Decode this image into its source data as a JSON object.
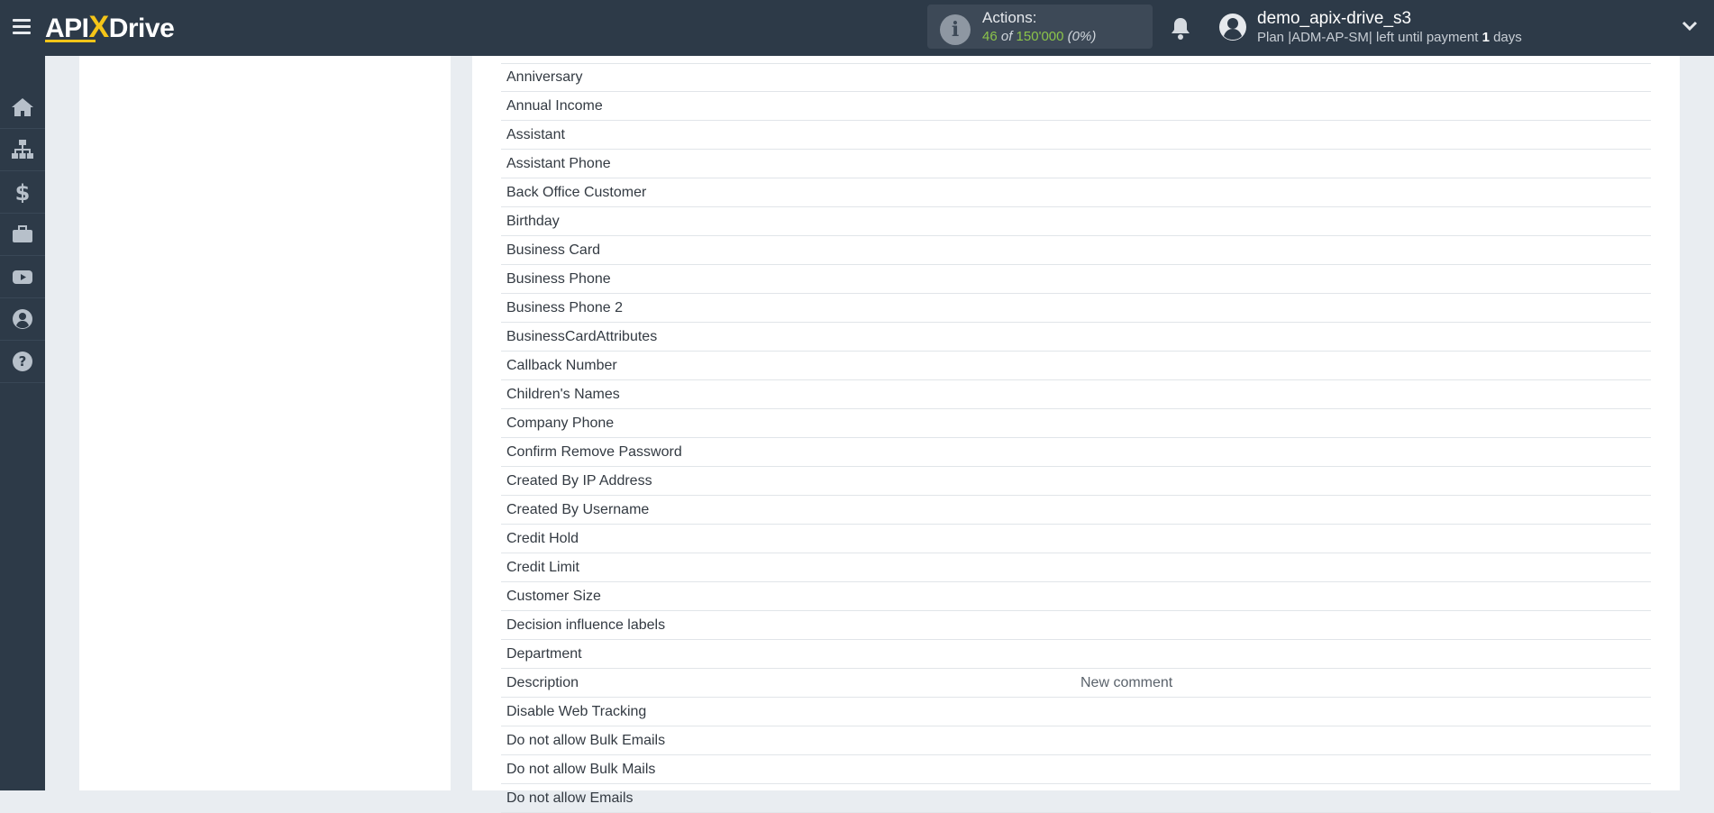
{
  "header": {
    "logo": {
      "api": "API",
      "x": "X",
      "drive": "Drive"
    },
    "actions": {
      "label": "Actions:",
      "used": "46",
      "of": "of",
      "total": "150'000",
      "percent": "(0%)"
    },
    "user": {
      "name": "demo_apix-drive_s3",
      "plan_prefix": "Plan |ADM-AP-SM| left until payment",
      "days_count": "1",
      "days_suffix": "days"
    }
  },
  "sidebar": {
    "items": [
      {
        "icon": "home-icon"
      },
      {
        "icon": "sitemap-icon"
      },
      {
        "icon": "dollar-icon"
      },
      {
        "icon": "briefcase-icon"
      },
      {
        "icon": "youtube-icon"
      },
      {
        "icon": "user-circle-icon"
      },
      {
        "icon": "question-circle-icon"
      }
    ]
  },
  "fields": [
    {
      "name": "Anniversary",
      "value": ""
    },
    {
      "name": "Annual Income",
      "value": ""
    },
    {
      "name": "Assistant",
      "value": ""
    },
    {
      "name": "Assistant Phone",
      "value": ""
    },
    {
      "name": "Back Office Customer",
      "value": ""
    },
    {
      "name": "Birthday",
      "value": ""
    },
    {
      "name": "Business Card",
      "value": ""
    },
    {
      "name": "Business Phone",
      "value": ""
    },
    {
      "name": "Business Phone 2",
      "value": ""
    },
    {
      "name": "BusinessCardAttributes",
      "value": ""
    },
    {
      "name": "Callback Number",
      "value": ""
    },
    {
      "name": "Children's Names",
      "value": ""
    },
    {
      "name": "Company Phone",
      "value": ""
    },
    {
      "name": "Confirm Remove Password",
      "value": ""
    },
    {
      "name": "Created By IP Address",
      "value": ""
    },
    {
      "name": "Created By Username",
      "value": ""
    },
    {
      "name": "Credit Hold",
      "value": ""
    },
    {
      "name": "Credit Limit",
      "value": ""
    },
    {
      "name": "Customer Size",
      "value": ""
    },
    {
      "name": "Decision influence labels",
      "value": ""
    },
    {
      "name": "Department",
      "value": ""
    },
    {
      "name": "Description",
      "value": "New comment"
    },
    {
      "name": "Disable Web Tracking",
      "value": ""
    },
    {
      "name": "Do not allow Bulk Emails",
      "value": ""
    },
    {
      "name": "Do not allow Bulk Mails",
      "value": ""
    },
    {
      "name": "Do not allow Emails",
      "value": ""
    }
  ],
  "colors": {
    "topbar": "#2d3a48",
    "accent_yellow": "#f5c518",
    "actions_green": "#8bc34a"
  }
}
